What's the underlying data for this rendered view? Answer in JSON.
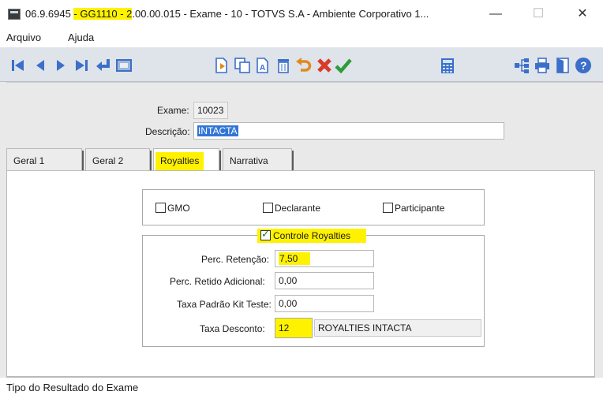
{
  "window": {
    "title_parts": [
      "06.9.6945 ",
      "- GG1110 - 2",
      ".00.00.015 - Exame - 10 - TOTVS S.A - Ambiente Corporativo 1..."
    ],
    "minimize": "—",
    "maximize": "☐",
    "close": "✕"
  },
  "menu": {
    "items": [
      "Arquivo",
      "Ajuda"
    ]
  },
  "toolbar": {
    "icons": [
      "first-record-icon",
      "previous-record-icon",
      "next-record-icon",
      "last-record-icon",
      "return-icon",
      "view-icon",
      "document-export-icon",
      "copy-icon",
      "rename-icon",
      "delete-icon",
      "undo-icon",
      "cancel-icon",
      "confirm-icon",
      "calculator-icon",
      "tree-icon",
      "print-icon",
      "exit-icon",
      "help-icon"
    ],
    "colors": {
      "nav_blue": "#3b6fc9",
      "green": "#2e9c3a",
      "red": "#d93b2b",
      "orange": "#e08a1e"
    }
  },
  "form": {
    "exame_label": "Exame:",
    "exame_value": "10023",
    "descricao_label": "Descrição:",
    "descricao_value": "INTACTA"
  },
  "tabs": [
    {
      "label": "Geral 1",
      "active": false
    },
    {
      "label": "Geral 2",
      "active": false
    },
    {
      "label": "Royalties",
      "active": true
    },
    {
      "label": "Narrativa",
      "active": false
    }
  ],
  "royalties": {
    "checkboxes": [
      {
        "label": "GMO",
        "checked": false
      },
      {
        "label": "Declarante",
        "checked": false
      },
      {
        "label": "Participante",
        "checked": false
      }
    ],
    "controle": {
      "label": "Controle Royalties",
      "checked": true
    },
    "fields": [
      {
        "label": "Perc. Retenção:",
        "value": "7,50"
      },
      {
        "label": "Perc. Retido Adicional:",
        "value": "0,00"
      },
      {
        "label": "Taxa Padrão Kit Teste:",
        "value": "0,00"
      },
      {
        "label": "Taxa Desconto:",
        "value": "12"
      }
    ],
    "taxa_desconto_desc": "ROYALTIES INTACTA"
  },
  "footer": {
    "text": "Tipo do Resultado do Exame"
  },
  "highlight_color": "#fff200"
}
